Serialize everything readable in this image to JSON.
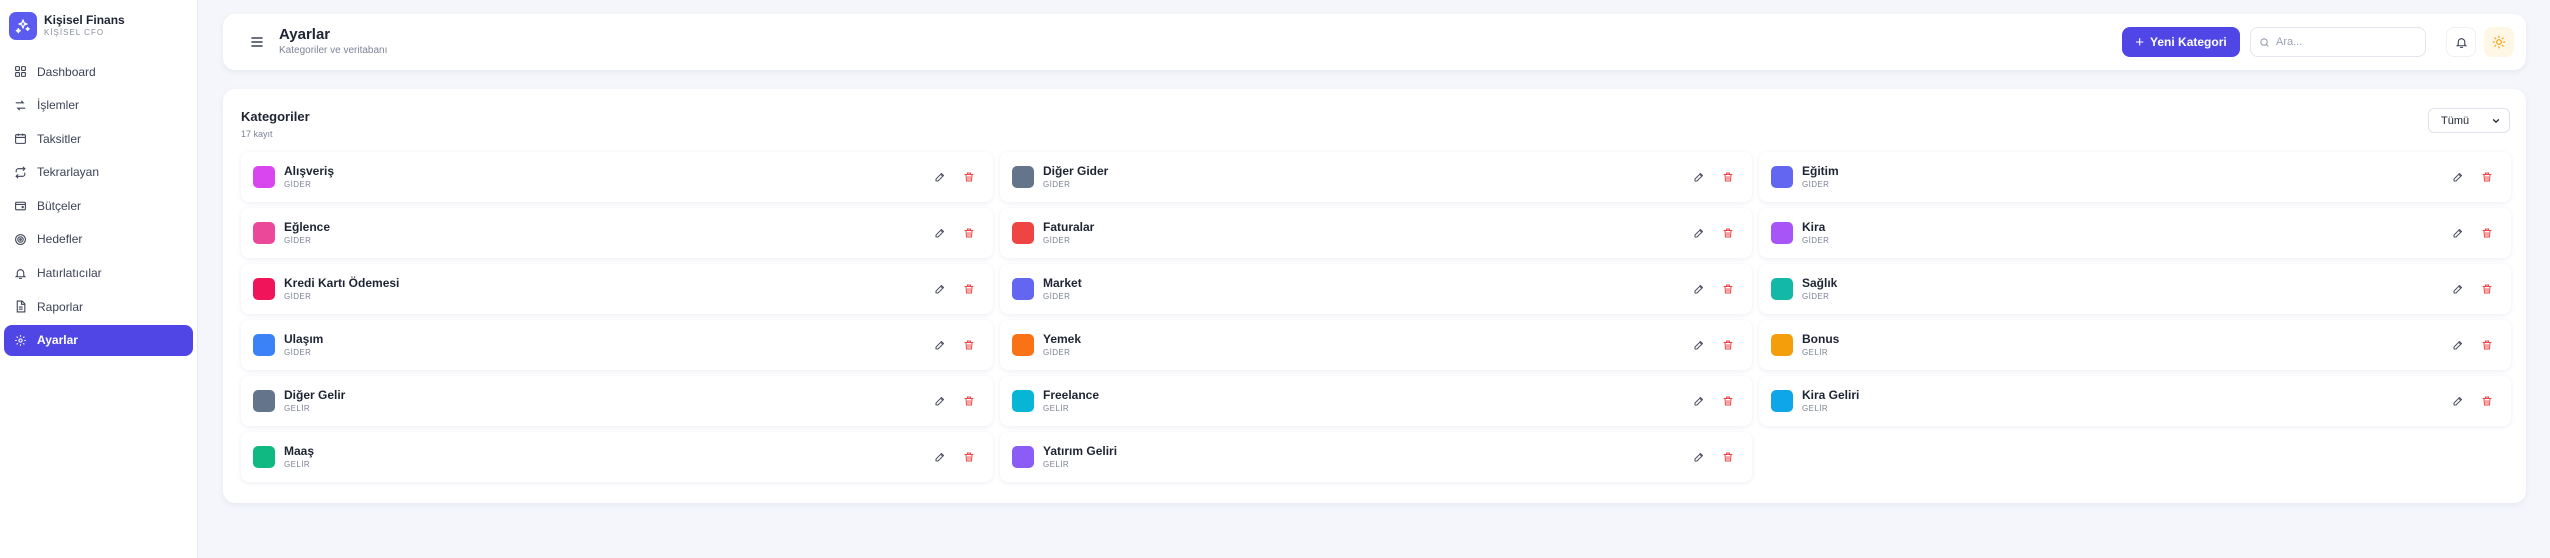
{
  "brand": {
    "title": "Kişisel Finans",
    "subtitle": "KİŞİSEL CFO"
  },
  "sidebar": {
    "items": [
      {
        "label": "Dashboard",
        "icon": "grid-icon"
      },
      {
        "label": "İşlemler",
        "icon": "arrows-icon"
      },
      {
        "label": "Taksitler",
        "icon": "calendar-icon"
      },
      {
        "label": "Tekrarlayan",
        "icon": "repeat-icon"
      },
      {
        "label": "Bütçeler",
        "icon": "wallet-icon"
      },
      {
        "label": "Hedefler",
        "icon": "target-icon"
      },
      {
        "label": "Hatırlatıcılar",
        "icon": "bell-icon"
      },
      {
        "label": "Raporlar",
        "icon": "file-icon"
      },
      {
        "label": "Ayarlar",
        "icon": "gear-icon",
        "active": true
      }
    ]
  },
  "header": {
    "title": "Ayarlar",
    "subtitle": "Kategoriler ve veritabanı",
    "new_button": "Yeni Kategori",
    "search_placeholder": "Ara..."
  },
  "main": {
    "title": "Kategoriler",
    "count": "17 kayıt",
    "filter_value": "Tümü"
  },
  "categories": [
    {
      "name": "Alışveriş",
      "type": "GİDER",
      "color": "#d946ef"
    },
    {
      "name": "Diğer Gider",
      "type": "GİDER",
      "color": "#64748b"
    },
    {
      "name": "Eğitim",
      "type": "GİDER",
      "color": "#6366f1"
    },
    {
      "name": "Eğlence",
      "type": "GİDER",
      "color": "#ec4899"
    },
    {
      "name": "Faturalar",
      "type": "GİDER",
      "color": "#ef4444"
    },
    {
      "name": "Kira",
      "type": "GİDER",
      "color": "#a855f7"
    },
    {
      "name": "Kredi Kartı Ödemesi",
      "type": "GİDER",
      "color": "#f0145a"
    },
    {
      "name": "Market",
      "type": "GİDER",
      "color": "#6366f1"
    },
    {
      "name": "Sağlık",
      "type": "GİDER",
      "color": "#14b8a6"
    },
    {
      "name": "Ulaşım",
      "type": "GİDER",
      "color": "#3b82f6"
    },
    {
      "name": "Yemek",
      "type": "GİDER",
      "color": "#f97316"
    },
    {
      "name": "Bonus",
      "type": "GELİR",
      "color": "#f59e0b"
    },
    {
      "name": "Diğer Gelir",
      "type": "GELİR",
      "color": "#64748b"
    },
    {
      "name": "Freelance",
      "type": "GELİR",
      "color": "#06b6d4"
    },
    {
      "name": "Kira Geliri",
      "type": "GELİR",
      "color": "#0ea5e9"
    },
    {
      "name": "Maaş",
      "type": "GELİR",
      "color": "#10b981"
    },
    {
      "name": "Yatırım Geliri",
      "type": "GELİR",
      "color": "#8b5cf6"
    }
  ]
}
